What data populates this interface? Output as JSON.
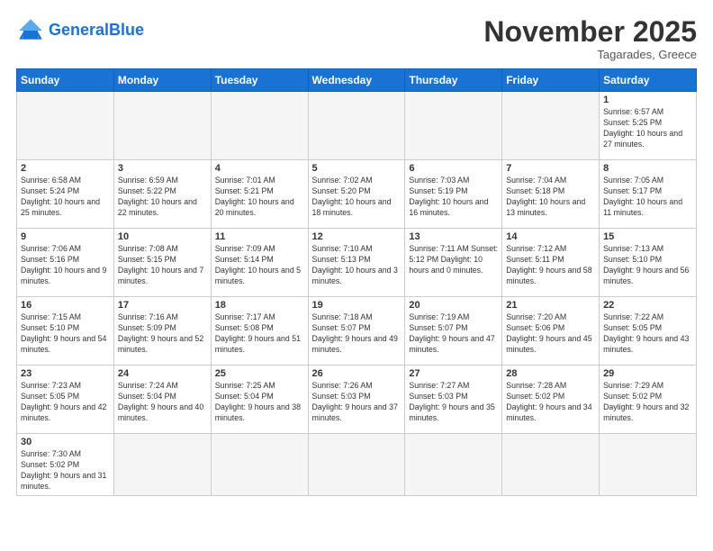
{
  "logo": {
    "text_general": "General",
    "text_blue": "Blue"
  },
  "header": {
    "month": "November 2025",
    "location": "Tagarades, Greece"
  },
  "weekdays": [
    "Sunday",
    "Monday",
    "Tuesday",
    "Wednesday",
    "Thursday",
    "Friday",
    "Saturday"
  ],
  "weeks": [
    [
      {
        "day": "",
        "info": ""
      },
      {
        "day": "",
        "info": ""
      },
      {
        "day": "",
        "info": ""
      },
      {
        "day": "",
        "info": ""
      },
      {
        "day": "",
        "info": ""
      },
      {
        "day": "",
        "info": ""
      },
      {
        "day": "1",
        "info": "Sunrise: 6:57 AM\nSunset: 5:25 PM\nDaylight: 10 hours\nand 27 minutes."
      }
    ],
    [
      {
        "day": "2",
        "info": "Sunrise: 6:58 AM\nSunset: 5:24 PM\nDaylight: 10 hours\nand 25 minutes."
      },
      {
        "day": "3",
        "info": "Sunrise: 6:59 AM\nSunset: 5:22 PM\nDaylight: 10 hours\nand 22 minutes."
      },
      {
        "day": "4",
        "info": "Sunrise: 7:01 AM\nSunset: 5:21 PM\nDaylight: 10 hours\nand 20 minutes."
      },
      {
        "day": "5",
        "info": "Sunrise: 7:02 AM\nSunset: 5:20 PM\nDaylight: 10 hours\nand 18 minutes."
      },
      {
        "day": "6",
        "info": "Sunrise: 7:03 AM\nSunset: 5:19 PM\nDaylight: 10 hours\nand 16 minutes."
      },
      {
        "day": "7",
        "info": "Sunrise: 7:04 AM\nSunset: 5:18 PM\nDaylight: 10 hours\nand 13 minutes."
      },
      {
        "day": "8",
        "info": "Sunrise: 7:05 AM\nSunset: 5:17 PM\nDaylight: 10 hours\nand 11 minutes."
      }
    ],
    [
      {
        "day": "9",
        "info": "Sunrise: 7:06 AM\nSunset: 5:16 PM\nDaylight: 10 hours\nand 9 minutes."
      },
      {
        "day": "10",
        "info": "Sunrise: 7:08 AM\nSunset: 5:15 PM\nDaylight: 10 hours\nand 7 minutes."
      },
      {
        "day": "11",
        "info": "Sunrise: 7:09 AM\nSunset: 5:14 PM\nDaylight: 10 hours\nand 5 minutes."
      },
      {
        "day": "12",
        "info": "Sunrise: 7:10 AM\nSunset: 5:13 PM\nDaylight: 10 hours\nand 3 minutes."
      },
      {
        "day": "13",
        "info": "Sunrise: 7:11 AM\nSunset: 5:12 PM\nDaylight: 10 hours\nand 0 minutes."
      },
      {
        "day": "14",
        "info": "Sunrise: 7:12 AM\nSunset: 5:11 PM\nDaylight: 9 hours\nand 58 minutes."
      },
      {
        "day": "15",
        "info": "Sunrise: 7:13 AM\nSunset: 5:10 PM\nDaylight: 9 hours\nand 56 minutes."
      }
    ],
    [
      {
        "day": "16",
        "info": "Sunrise: 7:15 AM\nSunset: 5:10 PM\nDaylight: 9 hours\nand 54 minutes."
      },
      {
        "day": "17",
        "info": "Sunrise: 7:16 AM\nSunset: 5:09 PM\nDaylight: 9 hours\nand 52 minutes."
      },
      {
        "day": "18",
        "info": "Sunrise: 7:17 AM\nSunset: 5:08 PM\nDaylight: 9 hours\nand 51 minutes."
      },
      {
        "day": "19",
        "info": "Sunrise: 7:18 AM\nSunset: 5:07 PM\nDaylight: 9 hours\nand 49 minutes."
      },
      {
        "day": "20",
        "info": "Sunrise: 7:19 AM\nSunset: 5:07 PM\nDaylight: 9 hours\nand 47 minutes."
      },
      {
        "day": "21",
        "info": "Sunrise: 7:20 AM\nSunset: 5:06 PM\nDaylight: 9 hours\nand 45 minutes."
      },
      {
        "day": "22",
        "info": "Sunrise: 7:22 AM\nSunset: 5:05 PM\nDaylight: 9 hours\nand 43 minutes."
      }
    ],
    [
      {
        "day": "23",
        "info": "Sunrise: 7:23 AM\nSunset: 5:05 PM\nDaylight: 9 hours\nand 42 minutes."
      },
      {
        "day": "24",
        "info": "Sunrise: 7:24 AM\nSunset: 5:04 PM\nDaylight: 9 hours\nand 40 minutes."
      },
      {
        "day": "25",
        "info": "Sunrise: 7:25 AM\nSunset: 5:04 PM\nDaylight: 9 hours\nand 38 minutes."
      },
      {
        "day": "26",
        "info": "Sunrise: 7:26 AM\nSunset: 5:03 PM\nDaylight: 9 hours\nand 37 minutes."
      },
      {
        "day": "27",
        "info": "Sunrise: 7:27 AM\nSunset: 5:03 PM\nDaylight: 9 hours\nand 35 minutes."
      },
      {
        "day": "28",
        "info": "Sunrise: 7:28 AM\nSunset: 5:02 PM\nDaylight: 9 hours\nand 34 minutes."
      },
      {
        "day": "29",
        "info": "Sunrise: 7:29 AM\nSunset: 5:02 PM\nDaylight: 9 hours\nand 32 minutes."
      }
    ],
    [
      {
        "day": "30",
        "info": "Sunrise: 7:30 AM\nSunset: 5:02 PM\nDaylight: 9 hours\nand 31 minutes."
      },
      {
        "day": "",
        "info": ""
      },
      {
        "day": "",
        "info": ""
      },
      {
        "day": "",
        "info": ""
      },
      {
        "day": "",
        "info": ""
      },
      {
        "day": "",
        "info": ""
      },
      {
        "day": "",
        "info": ""
      }
    ]
  ]
}
